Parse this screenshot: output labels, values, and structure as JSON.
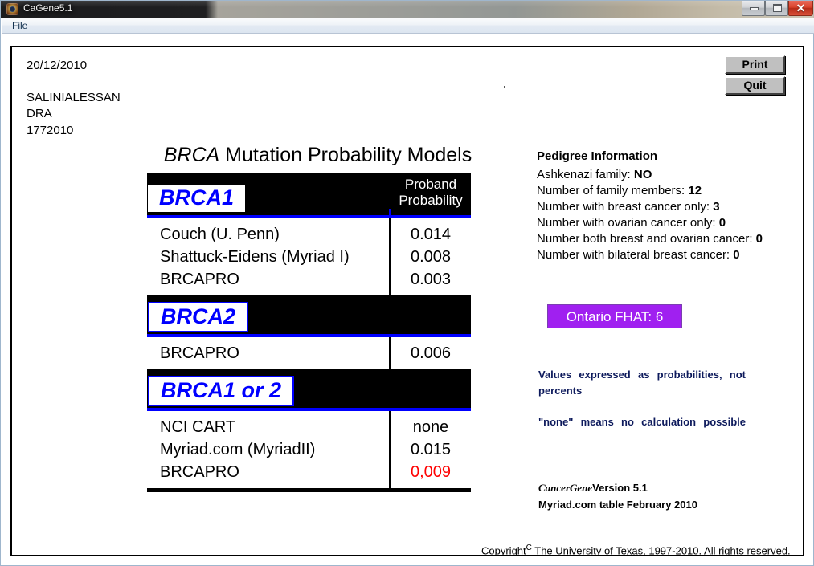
{
  "window": {
    "title": "CaGene5.1",
    "app_icon": "cagene-app-icon",
    "minimize_label": "",
    "maximize_label": "",
    "close_label": "✕"
  },
  "menu": {
    "file_label": "File"
  },
  "header": {
    "date": "20/12/2010",
    "patient_name": "SALINIALESSAN",
    "line2": "DRA",
    "line3": "1772010"
  },
  "toolbar": {
    "print_label": "Print",
    "quit_label": "Quit"
  },
  "report": {
    "title_italic": "BRCA",
    "title_rest": " Mutation Probability Models",
    "column_header_line1": "Proband",
    "column_header_line2": "Probability",
    "sections": [
      {
        "tag": "BRCA1",
        "rows": [
          {
            "model": "Couch (U. Penn)",
            "value": "0.014",
            "color": "black"
          },
          {
            "model": "Shattuck-Eidens (Myriad I)",
            "value": "0.008",
            "color": "black"
          },
          {
            "model": "BRCAPRO",
            "value": "0.003",
            "color": "black"
          }
        ]
      },
      {
        "tag": "BRCA2",
        "rows": [
          {
            "model": "BRCAPRO",
            "value": "0.006",
            "color": "black"
          }
        ]
      },
      {
        "tag": "BRCA1 or 2",
        "rows": [
          {
            "model": "NCI CART",
            "value": "none",
            "color": "black"
          },
          {
            "model": "Myriad.com (MyriadII)",
            "value": "0.015",
            "color": "black"
          },
          {
            "model": "BRCAPRO",
            "value": "0,009",
            "color": "red"
          }
        ]
      }
    ]
  },
  "pedigree": {
    "title": "Pedigree Information",
    "items": [
      {
        "label": "Ashkenazi family: ",
        "value": "NO"
      },
      {
        "label": "Number of family members: ",
        "value": "12"
      },
      {
        "label": "Number with breast cancer only: ",
        "value": "3"
      },
      {
        "label": "Number with ovarian cancer only: ",
        "value": "0"
      },
      {
        "label": "Number both breast and ovarian cancer: ",
        "value": "0"
      },
      {
        "label": "Number with bilateral breast cancer: ",
        "value": "0"
      }
    ]
  },
  "fhat": {
    "label": "Ontario FHAT: 6",
    "color": "#a020f0"
  },
  "notes": {
    "note1": "Values expressed as probabilities, not percents",
    "note2": "\"none\" means no calculation possible"
  },
  "footer": {
    "cancergene_italic": "CancerGene",
    "version": "Version 5.1",
    "myriad_table": "Myriad.com table February 2010",
    "copyright_pre": "Copyright",
    "copyright_sym": "C",
    "copyright_post": " The University of Texas, 1997-2010.  All rights reserved."
  }
}
